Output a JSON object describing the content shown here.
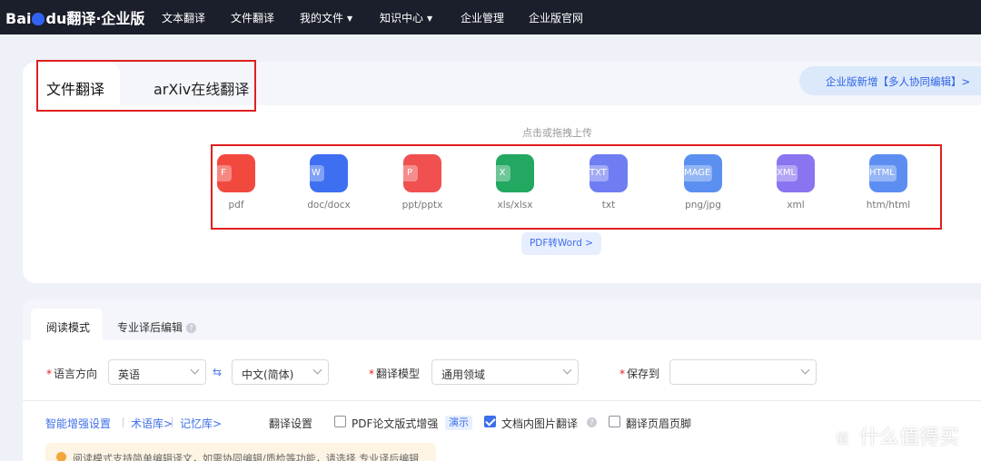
{
  "brand": {
    "logo_text": "Bai",
    "logo_text2": "du",
    "product": "翻译·企业版"
  },
  "nav": {
    "items": [
      {
        "label": "文本翻译",
        "caret": false
      },
      {
        "label": "文件翻译",
        "caret": false
      },
      {
        "label": "我的文件",
        "caret": true
      },
      {
        "label": "知识中心",
        "caret": true
      },
      {
        "label": "企业管理",
        "caret": false
      },
      {
        "label": "企业版官网",
        "caret": false
      }
    ]
  },
  "upload": {
    "tabs": [
      "文件翻译",
      "arXiv在线翻译"
    ],
    "active_tab": "文件翻译",
    "banner": "企业版新增【多人协同编辑】>",
    "hint": "点击或拖拽上传",
    "file_types": [
      {
        "label": "pdf",
        "tag": "F",
        "color": "#f2493f",
        "icon": "pdf-file-icon"
      },
      {
        "label": "doc/docx",
        "tag": "W",
        "color": "#3d6ff0",
        "icon": "word-file-icon"
      },
      {
        "label": "ppt/pptx",
        "tag": "P",
        "color": "#f05050",
        "icon": "ppt-file-icon"
      },
      {
        "label": "xls/xlsx",
        "tag": "X",
        "color": "#22a861",
        "icon": "excel-file-icon"
      },
      {
        "label": "txt",
        "tag": "TXT",
        "color": "#6f7df2",
        "icon": "txt-file-icon"
      },
      {
        "label": "png/jpg",
        "tag": "MAGE",
        "color": "#5b8ff0",
        "icon": "image-file-icon"
      },
      {
        "label": "xml",
        "tag": "XML",
        "color": "#8b74f0",
        "icon": "xml-file-icon"
      },
      {
        "label": "htm/html",
        "tag": "HTML",
        "color": "#5c8ef2",
        "icon": "html-file-icon"
      }
    ],
    "pdf_to_word": "PDF转Word >"
  },
  "settings": {
    "tabs": [
      "阅读模式",
      "专业译后编辑"
    ],
    "active_tab": "阅读模式",
    "lang_label": "语言方向",
    "source_lang": "英语",
    "swap_icon": "⇆",
    "target_lang": "中文(简体)",
    "model_label": "翻译模型",
    "model_value": "通用领域",
    "save_label": "保存到",
    "save_value": "",
    "links": [
      "智能增强设置",
      "术语库>",
      "记忆库>"
    ],
    "trans_settings": "翻译设置",
    "options": [
      {
        "label": "PDF论文版式增强",
        "checked": false
      },
      {
        "label": "文档内图片翻译",
        "checked": true
      },
      {
        "label": "翻译页眉页脚",
        "checked": false
      }
    ],
    "demo": "演示",
    "notice": "阅读模式支持简单编辑译文，如需协同编辑/质检等功能，请选择 专业译后编辑"
  },
  "watermark": {
    "logo": "值",
    "text": "什么值得买"
  }
}
